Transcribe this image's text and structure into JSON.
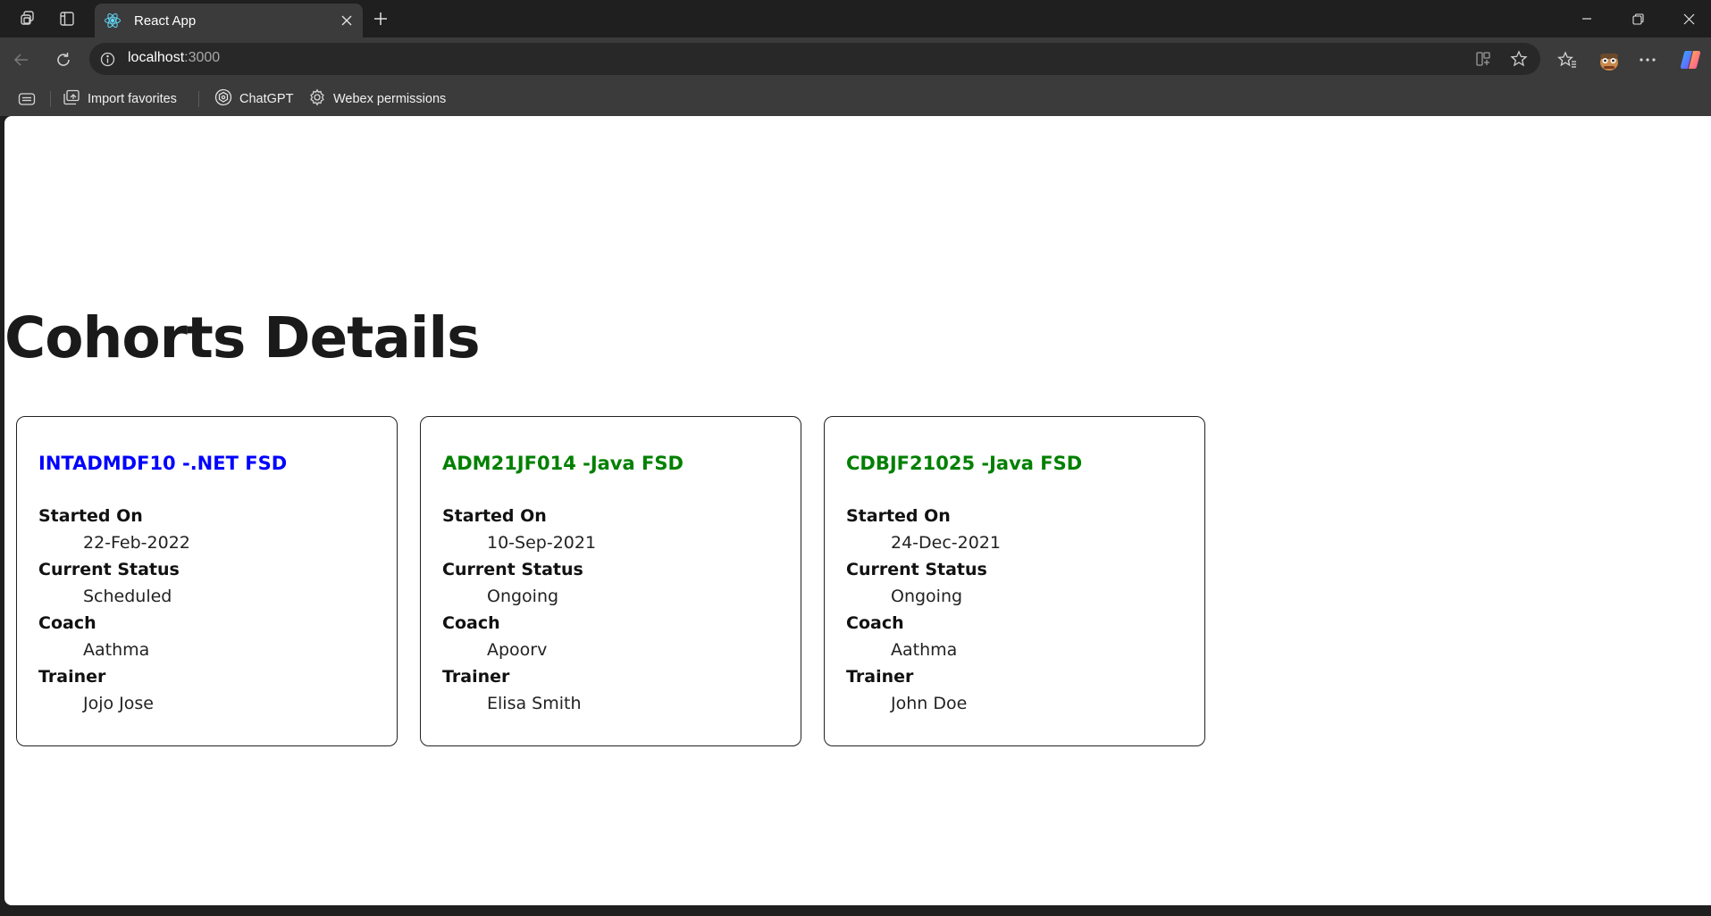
{
  "browser": {
    "tab_title": "React App",
    "url_host": "localhost",
    "url_port": ":3000",
    "favorites": [
      {
        "label": "Import favorites",
        "icon": "import-icon"
      },
      {
        "label": "ChatGPT",
        "icon": "chatgpt-icon"
      },
      {
        "label": "Webex permissions",
        "icon": "gear-icon"
      }
    ]
  },
  "page": {
    "title": "Cohorts Details",
    "labels": {
      "started_on": "Started On",
      "current_status": "Current Status",
      "coach": "Coach",
      "trainer": "Trainer"
    },
    "cohorts": [
      {
        "title": "INTADMDF10 -.NET FSD",
        "started_on": "22-Feb-2022",
        "status": "Scheduled",
        "coach": "Aathma",
        "trainer": "Jojo Jose",
        "title_color": "#0000ff"
      },
      {
        "title": "ADM21JF014 -Java FSD",
        "started_on": "10-Sep-2021",
        "status": "Ongoing",
        "coach": "Apoorv",
        "trainer": "Elisa Smith",
        "title_color": "#008000"
      },
      {
        "title": "CDBJF21025 -Java FSD",
        "started_on": "24-Dec-2021",
        "status": "Ongoing",
        "coach": "Aathma",
        "trainer": "John Doe",
        "title_color": "#008000"
      }
    ]
  }
}
